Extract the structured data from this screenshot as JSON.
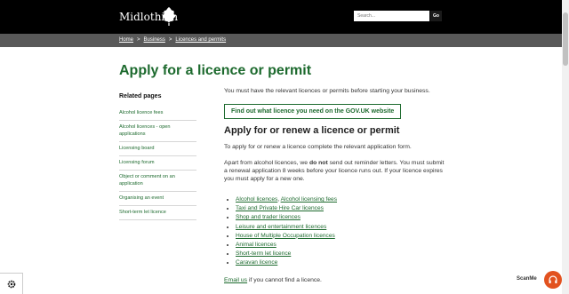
{
  "header": {
    "logo_text": "Midlothian",
    "search": {
      "placeholder": "Search..."
    },
    "go_label": "Go"
  },
  "breadcrumb": [
    "Home",
    "Business",
    "Licences and permits"
  ],
  "page_title": "Apply for a licence or permit",
  "related": {
    "heading": "Related pages",
    "items": [
      "Alcohol licence fees",
      "Alcohol licences - open applications",
      "Licensing board",
      "Licensing forum",
      "Object or comment on an application",
      "Organising an event",
      "Short-term let licence"
    ]
  },
  "main": {
    "intro": "You must have the relevant licences or permits before starting your business.",
    "cta_button": "Find out what licence you need on the GOV.UK website",
    "section_heading": "Apply for or renew a licence or permit",
    "para1": "To apply for or renew a licence complete the relevant application form.",
    "para2_before": "Apart from alcohol licences, we ",
    "para2_bold": "do not",
    "para2_after": " send out reminder letters. You must submit a renewal application 8 weeks before your licence runs out. If your licence expires you must apply for a new one.",
    "link1a": "Alcohol licences",
    "link1_sep": ", ",
    "link1b": "Alcohol licensing fees",
    "links": [
      "Taxi and Private Hire Car licences",
      "Shop and trader licences",
      "Leisure and entertainment licences",
      "House of Multiple Occupation licences",
      "Animal licences",
      "Short-term let licence",
      "Caravan licence"
    ],
    "email_link": "Email us",
    "email_after": " if you cannot find a licence."
  },
  "widgets": {
    "scanmedia_label": "ScanMe"
  },
  "colors": {
    "brand_green": "#1d6a2e",
    "header_bg": "#000000",
    "breadcrumb_bg": "#595959",
    "audio_button": "#e2521f"
  }
}
